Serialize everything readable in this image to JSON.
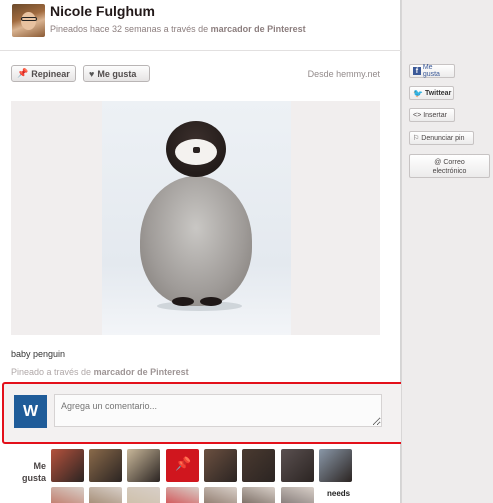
{
  "header": {
    "username": "Nicole Fulghum",
    "subline_prefix": "Pineados hace 32 semanas a través de ",
    "subline_source": "marcador de Pinterest"
  },
  "actions": {
    "repin_label": "Repinear",
    "like_label": "Me gusta",
    "source_text": "Desde hemmy.net"
  },
  "pin": {
    "caption": "baby penguin",
    "pinned_prefix": "Pineado a través de ",
    "pinned_source": "marcador de Pinterest"
  },
  "comment": {
    "avatar_letter": "W",
    "placeholder": "Agrega un comentario..."
  },
  "likes": {
    "label": "Me gusta",
    "thumbs": [
      {
        "name": "liker-avatar-1",
        "color": "#b5523d"
      },
      {
        "name": "liker-avatar-2",
        "color": "#8a6a4a"
      },
      {
        "name": "liker-avatar-3",
        "color": "#c9b89a"
      },
      {
        "name": "liker-avatar-pinterest",
        "color": "#d0161e"
      },
      {
        "name": "liker-avatar-5",
        "color": "#6b5040"
      },
      {
        "name": "liker-avatar-6",
        "color": "#4a3a30"
      },
      {
        "name": "liker-avatar-7",
        "color": "#5a5050"
      },
      {
        "name": "liker-avatar-8",
        "color": "#8a98a8"
      }
    ],
    "row2_text": "needs"
  },
  "sidebar": {
    "facebook_label": "Me gusta",
    "tweet_label": "Twittear",
    "embed_label": "Insertar",
    "report_label": "Denunciar pin",
    "email_label_1": "Correo",
    "email_label_2": "electrónico"
  }
}
